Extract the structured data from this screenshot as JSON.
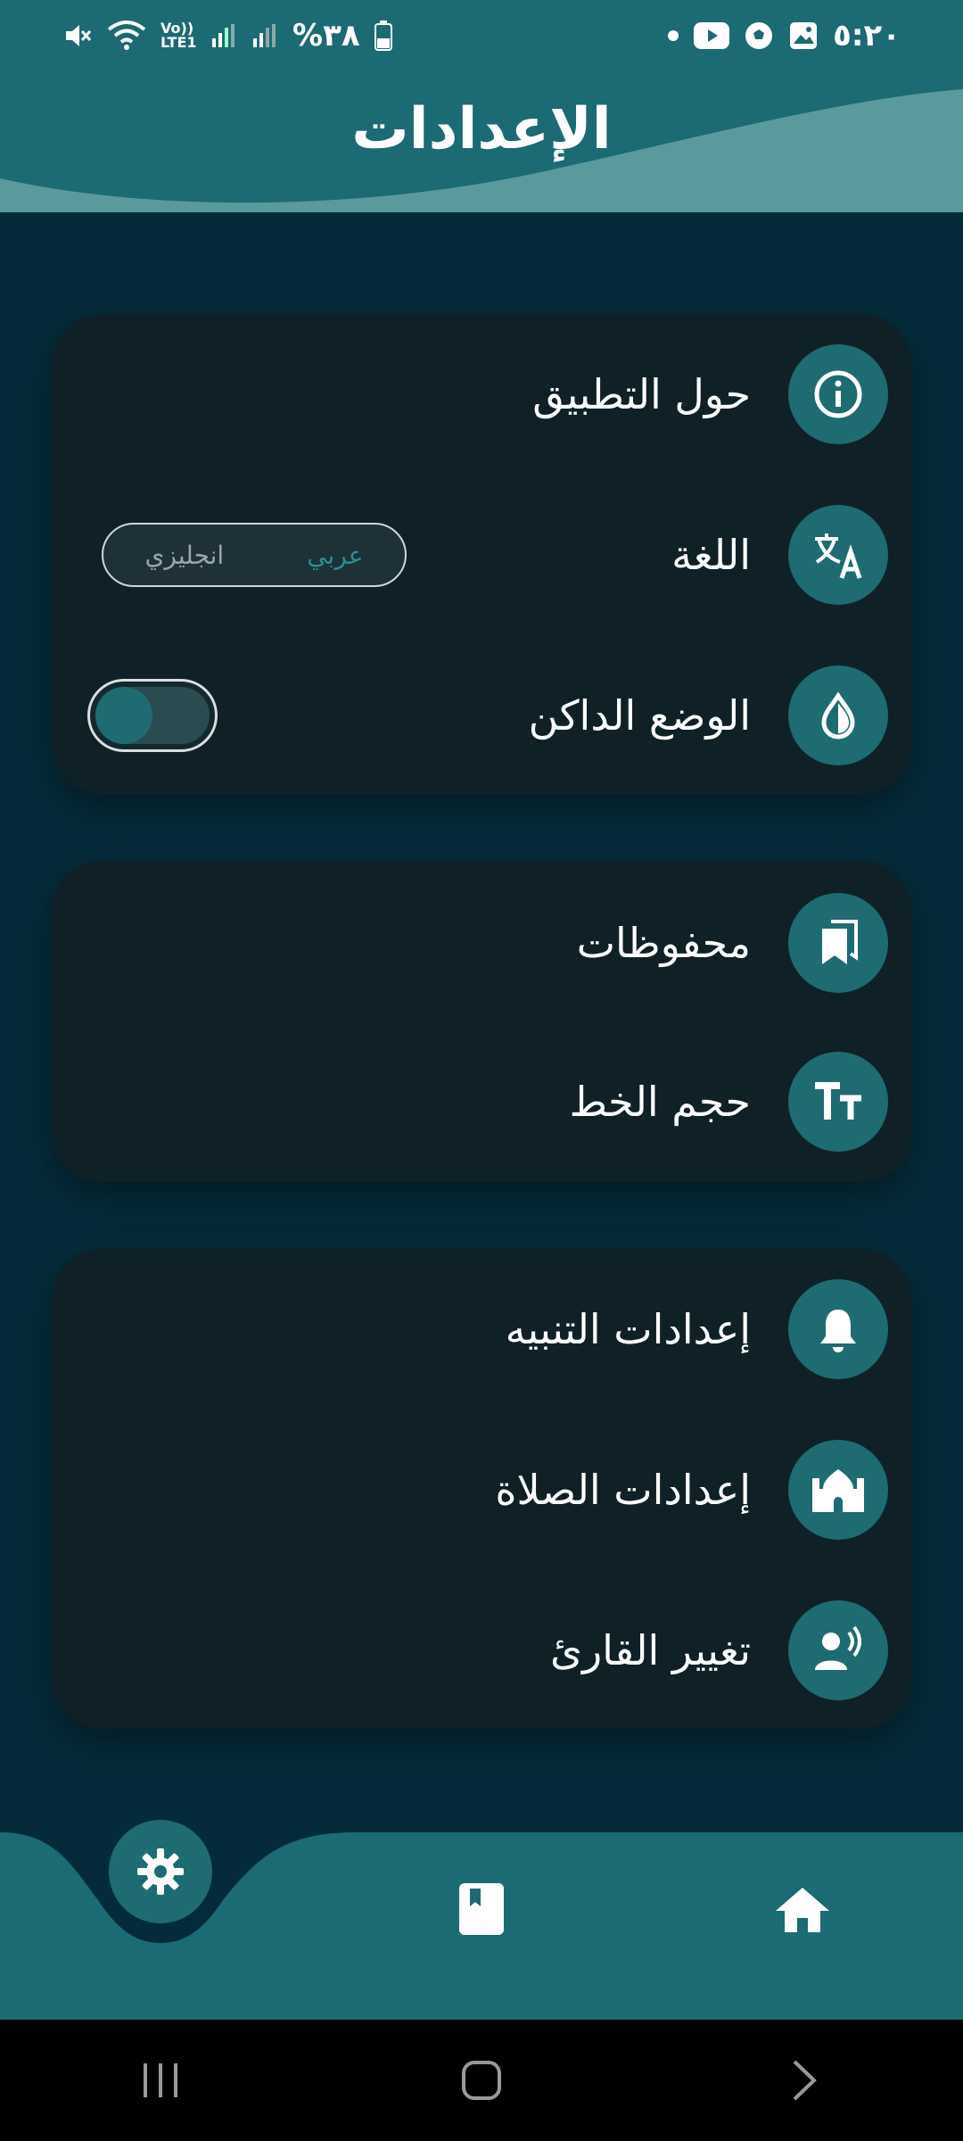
{
  "status_bar": {
    "time": "٥:٢٠",
    "battery": "%٣٨",
    "network": "Vo)) LTE1",
    "icons": [
      "dot-icon",
      "youtube-icon",
      "football-icon",
      "gallery-icon",
      "battery-icon",
      "signal-icon",
      "signal-icon",
      "wifi-icon",
      "mute-icon"
    ]
  },
  "header": {
    "title": "الإعدادات"
  },
  "sections": [
    {
      "items": [
        {
          "label": "حول التطبيق",
          "icon": "info-icon"
        },
        {
          "label": "اللغة",
          "icon": "translate-icon",
          "control": {
            "type": "segmented",
            "options": [
              "انجليزي",
              "عربي"
            ],
            "selected": "عربي"
          }
        },
        {
          "label": "الوضع الداكن",
          "icon": "water-drop-icon",
          "control": {
            "type": "switch",
            "on": false
          }
        }
      ]
    },
    {
      "items": [
        {
          "label": "محفوظات",
          "icon": "bookmarks-icon"
        },
        {
          "label": "حجم الخط",
          "icon": "text-size-icon"
        }
      ]
    },
    {
      "items": [
        {
          "label": "إعدادات التنبيه",
          "icon": "bell-icon"
        },
        {
          "label": "إعدادات الصلاة",
          "icon": "mosque-icon"
        },
        {
          "label": "تغيير القارئ",
          "icon": "speaking-person-icon"
        }
      ]
    }
  ],
  "bottom_nav": {
    "items": [
      {
        "name": "settings",
        "icon": "gear-icon",
        "active": true
      },
      {
        "name": "book",
        "icon": "book-icon",
        "active": false
      },
      {
        "name": "home",
        "icon": "home-icon",
        "active": false
      }
    ]
  },
  "colors": {
    "background": "#052b3a",
    "header": "#1c6a73",
    "card": "#0f2126",
    "accent": "#1e6b72",
    "text": "#ffffff"
  }
}
